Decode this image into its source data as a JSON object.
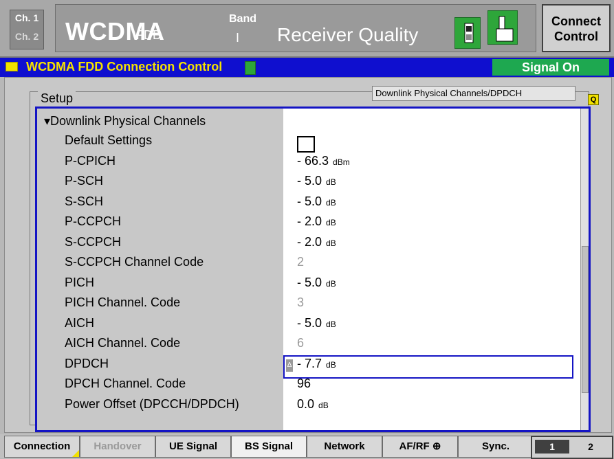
{
  "header": {
    "channel1": "Ch. 1",
    "channel2": "Ch. 2",
    "mode": "WCDMA",
    "mode_sub": "FDD",
    "band_label": "Band",
    "band_value": "I",
    "app_title": "Receiver Quality",
    "connect_control": "Connect Control"
  },
  "title_bar": {
    "title": "WCDMA FDD Connection Control",
    "status": "Signal On"
  },
  "setup": {
    "label": "Setup",
    "breadcrumb": "Downlink Physical Channels/DPDCH",
    "group": "▾Downlink Physical Channels",
    "rows": [
      {
        "label": "Default Settings",
        "value": "",
        "unit": "",
        "type": "checkbox"
      },
      {
        "label": "P-CPICH",
        "value": "- 66.3",
        "unit": "dBm"
      },
      {
        "label": "P-SCH",
        "value": "- 5.0",
        "unit": "dB"
      },
      {
        "label": "S-SCH",
        "value": "- 5.0",
        "unit": "dB"
      },
      {
        "label": "P-CCPCH",
        "value": "- 2.0",
        "unit": "dB"
      },
      {
        "label": "S-CCPCH",
        "value": "- 2.0",
        "unit": "dB"
      },
      {
        "label": "S-CCPCH Channel Code",
        "value": "2",
        "unit": "",
        "grey": true
      },
      {
        "label": "PICH",
        "value": "- 5.0",
        "unit": "dB"
      },
      {
        "label": "PICH Channel. Code",
        "value": "3",
        "unit": "",
        "grey": true
      },
      {
        "label": "AICH",
        "value": "- 5.0",
        "unit": "dB"
      },
      {
        "label": "AICH Channel. Code",
        "value": "6",
        "unit": "",
        "grey": true
      },
      {
        "label": "DPDCH",
        "value": "- 7.7",
        "unit": "dB",
        "selected": true
      },
      {
        "label": "DPCH Channel. Code",
        "value": "96",
        "unit": ""
      },
      {
        "label": "Power Offset (DPCCH/DPDCH)",
        "value": "0.0",
        "unit": "dB"
      }
    ]
  },
  "tabs": [
    {
      "label": "Connection"
    },
    {
      "label": "Handover",
      "disabled": true
    },
    {
      "label": "UE Signal"
    },
    {
      "label": "BS Signal",
      "active": true
    },
    {
      "label": "Network"
    },
    {
      "label": "AF/RF ⊕"
    },
    {
      "label": "Sync."
    }
  ],
  "pager": {
    "page1": "1",
    "page2": "2"
  }
}
